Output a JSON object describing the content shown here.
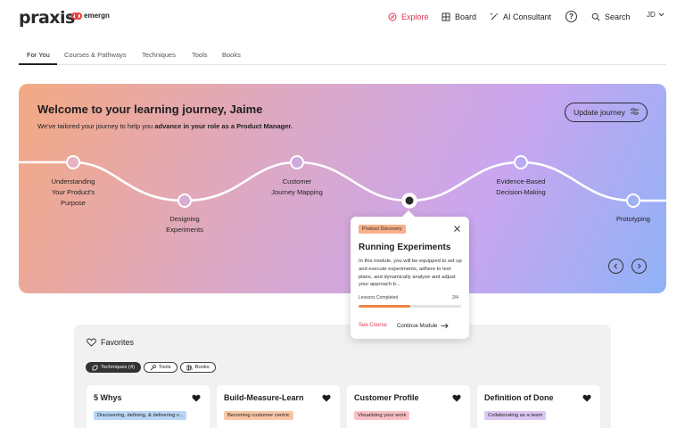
{
  "brand": {
    "logo": "praxis",
    "by": "by",
    "partner": "emergn",
    "partner_color": "#e23b3b"
  },
  "nav": {
    "explore": "Explore",
    "board": "Board",
    "consultant": "AI Consultant",
    "help": "?",
    "search": "Search",
    "user_initials": "JD",
    "active_color": "#e0344f"
  },
  "tabs": [
    "For You",
    "Courses & Pathways",
    "Techniques",
    "Tools",
    "Books"
  ],
  "hero": {
    "title": "Welcome to your learning journey, Jaime",
    "subtitle_prefix": "We've tailored your journey to help you ",
    "subtitle_bold": "advance in your role as a Product Manager.",
    "update_button": "Update journey",
    "nodes": [
      {
        "line1": "Understanding",
        "line2": "Your Product's",
        "line3": "Purpose"
      },
      {
        "line1": "Designing",
        "line2": "Experiments",
        "line3": ""
      },
      {
        "line1": "Customer",
        "line2": "Journey Mapping",
        "line3": ""
      },
      {
        "line1": "Evidence-Based",
        "line2": "Decision-Making",
        "line3": ""
      },
      {
        "line1": "Prototyping",
        "line2": "",
        "line3": ""
      }
    ]
  },
  "popup": {
    "badge": "Product Discovery",
    "title": "Running Experiments",
    "description": "In this module, you will be equipped to set up and execute experiments, adhere to test plans, and dynamically analyze and adjust your approach b...",
    "progress_label": "Lessons Completed",
    "progress_count": "2/4",
    "progress_fraction": 0.5,
    "see_course": "See Course",
    "continue": "Continue Module"
  },
  "favorites": {
    "title": "Favorites",
    "filters": [
      {
        "label": "Techniques (4)",
        "icon": "technique-icon",
        "active": true
      },
      {
        "label": "Tools",
        "icon": "tools-icon",
        "active": false
      },
      {
        "label": "Books",
        "icon": "books-icon",
        "active": false
      }
    ],
    "cards": [
      {
        "title": "5 Whys",
        "tag": "Discovering, defining, & delivering v...",
        "tag_color": "#b9d6f5"
      },
      {
        "title": "Build-Measure-Learn",
        "tag": "Becoming customer centric",
        "tag_color": "#f9c7a6"
      },
      {
        "title": "Customer Profile",
        "tag": "Visualizing your work",
        "tag_color": "#f8c0c5"
      },
      {
        "title": "Definition of Done",
        "tag": "Collaborating as a team",
        "tag_color": "#dcc7f2"
      }
    ]
  }
}
